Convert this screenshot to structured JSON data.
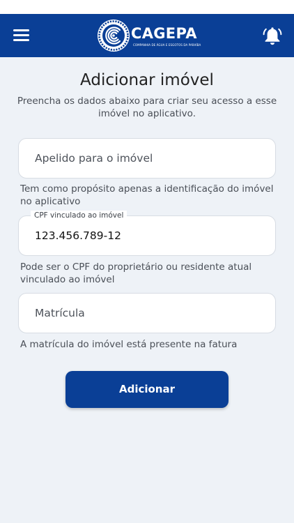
{
  "header": {
    "brand_name": "CAGEPA",
    "brand_tagline": "COMPANHIA DE ÁGUA E ESGOTOS DA PARAÍBA",
    "menu_icon": "hamburger-menu-icon",
    "notification_icon": "bell-ringing-icon",
    "logo_icon": "cagepa-logo-icon"
  },
  "page": {
    "title": "Adicionar imóvel",
    "subtitle": "Preencha os dados abaixo para criar seu acesso a esse imóvel no aplicativo."
  },
  "form": {
    "nickname": {
      "placeholder": "Apelido para o imóvel",
      "value": "",
      "helper": "Tem como propósito apenas a identificação do imóvel no aplicativo"
    },
    "cpf": {
      "label": "CPF vinculado ao imóvel",
      "value": "123.456.789-12",
      "helper": "Pode ser o CPF do proprietário ou residente atual vinculado ao imóvel"
    },
    "registration": {
      "placeholder": "Matrícula",
      "value": "",
      "helper": "A matrícula do imóvel está presente na fatura"
    },
    "submit_label": "Adicionar"
  },
  "colors": {
    "primary": "#0a3f96",
    "background": "#eef2f7",
    "field_background": "#ffffff",
    "field_border": "#d7dce3",
    "text": "#222222",
    "muted_text": "#4a4f57"
  }
}
